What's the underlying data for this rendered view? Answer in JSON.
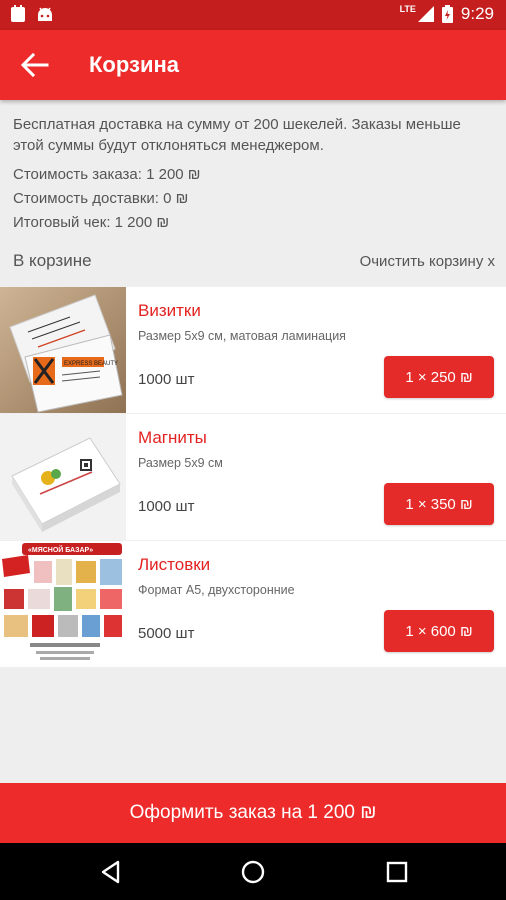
{
  "status": {
    "time": "9:29",
    "network": "LTE",
    "icons": [
      "app-notification-icon",
      "android-icon",
      "signal-icon",
      "battery-charging-icon"
    ]
  },
  "appbar": {
    "title": "Корзина",
    "back_icon": "arrow-back-icon"
  },
  "info": {
    "notice": "Бесплатная доставка на сумму от  200 шекелей.  Заказы меньше этой суммы будут отклоняться менеджером.",
    "order_cost": "Стоимость заказа: 1 200 ₪",
    "delivery_cost": "Стоимость доставки: 0 ₪",
    "total": "Итоговый чек: 1 200 ₪"
  },
  "cart": {
    "label": "В корзине",
    "clear": "Очистить корзину x",
    "items": [
      {
        "name": "Визитки",
        "desc": "Размер 5х9 см, матовая ламинация",
        "qty": "1000 шт",
        "price": "1 × 250 ₪",
        "thumb_text": "EXPRESS BEAUTY"
      },
      {
        "name": "Магниты",
        "desc": "Размер 5х9 см",
        "qty": "1000 шт",
        "price": "1 × 350 ₪",
        "thumb_text": ""
      },
      {
        "name": "Листовки",
        "desc": "Формат А5, двухсторонние",
        "qty": "5000 шт",
        "price": "1 × 600 ₪",
        "thumb_text": "«МЯСНОЙ БАЗАР»"
      }
    ]
  },
  "checkout": {
    "label": "Оформить заказ на 1 200 ₪"
  },
  "colors": {
    "primary": "#ee2b2b",
    "primary_dark": "#c41e1e",
    "accent_text": "#e32222"
  }
}
